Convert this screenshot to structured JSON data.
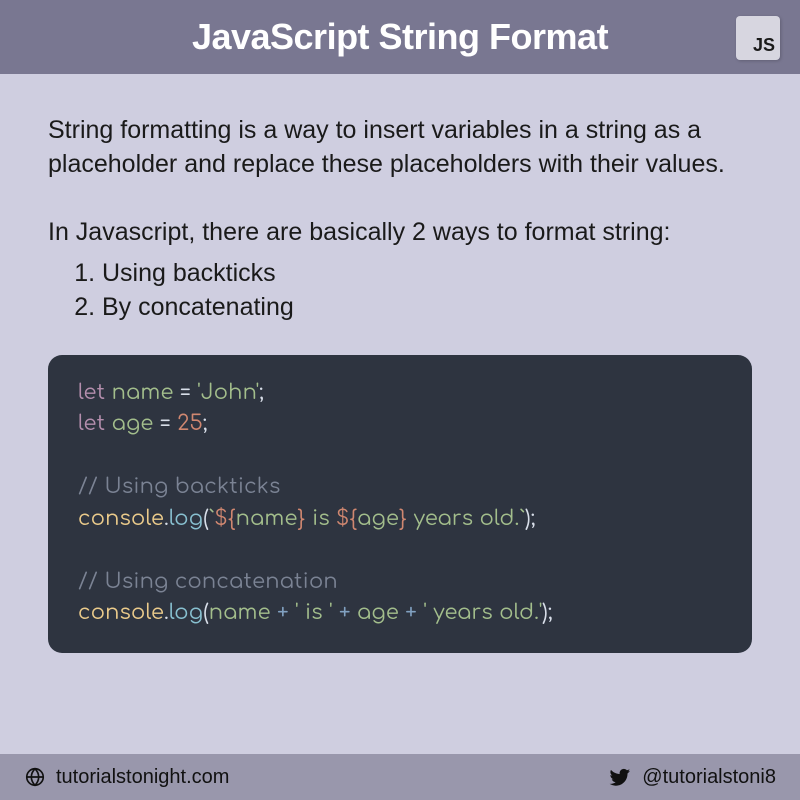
{
  "header": {
    "title": "JavaScript String Format",
    "badge": "JS"
  },
  "content": {
    "intro": "String formatting is a way to insert variables in a string as a placeholder and replace these placeholders with their values.",
    "waysIntro": "In Javascript, there are basically 2 ways to format string:",
    "ways": [
      "Using backticks",
      "By concatenating"
    ]
  },
  "code": {
    "line1": {
      "let": "let",
      "name": "name",
      "eq": " = ",
      "val": "'John'",
      "semi": ";"
    },
    "line2": {
      "let": "let",
      "name": "age",
      "eq": " = ",
      "val": "25",
      "semi": ";"
    },
    "comment1": "// Using backticks",
    "line3": {
      "obj": "console",
      "dot": ".",
      "prop": "log",
      "lp": "(",
      "bt1": "`",
      "t1": "${",
      "v1": "name",
      "t1c": "}",
      "mid": " is ",
      "t2": "${",
      "v2": "age",
      "t2c": "}",
      "end": " years old.",
      "bt2": "`",
      "rp": ")",
      "semi": ";"
    },
    "comment2": "// Using concatenation",
    "line4": {
      "obj": "console",
      "dot": ".",
      "prop": "log",
      "lp": "(",
      "v1": "name",
      "p1": " + ",
      "s1": "' is '",
      "p2": " + ",
      "v2": "age",
      "p3": " + ",
      "s2": "' years old.'",
      "rp": ")",
      "semi": ";"
    }
  },
  "footer": {
    "site": "tutorialstonight.com",
    "handle": "@tutorialstoni8"
  }
}
